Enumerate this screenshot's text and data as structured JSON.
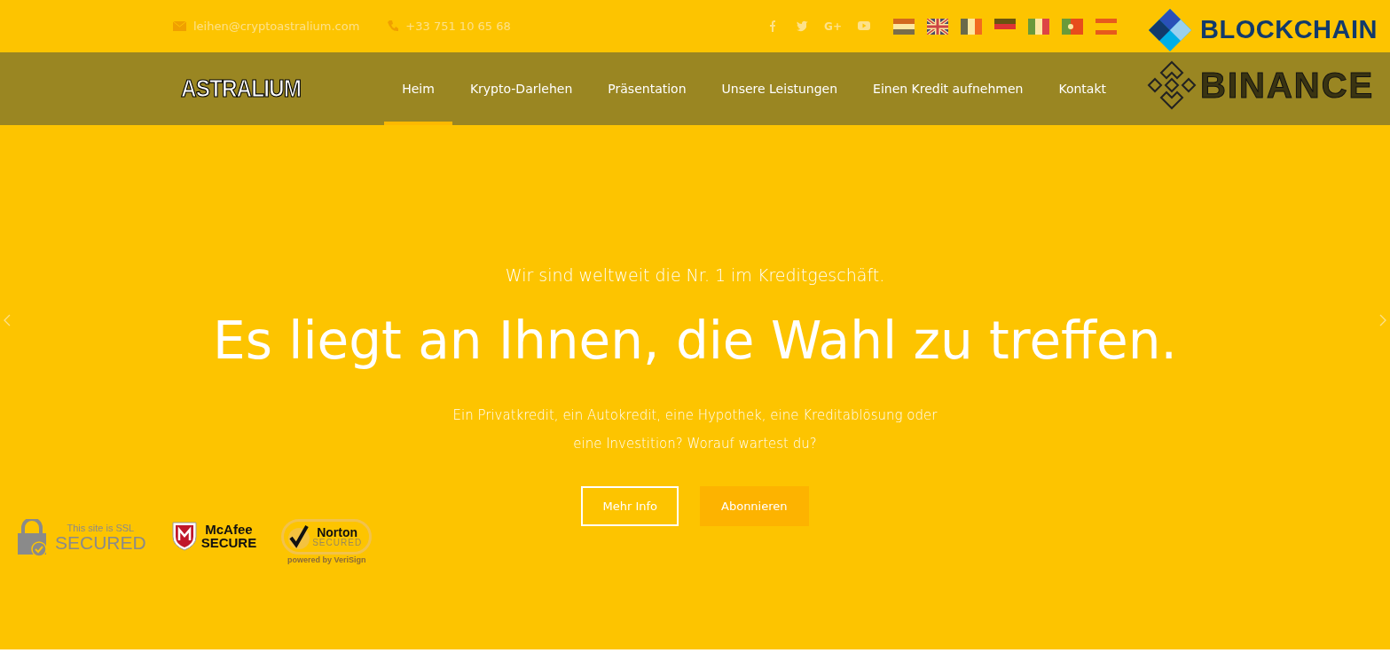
{
  "topbar": {
    "email": "leihen@cryptoastralium.com",
    "phone": "+33 751 10 65 68",
    "social": [
      {
        "kind": "facebook"
      },
      {
        "kind": "twitter"
      },
      {
        "kind": "googleplus",
        "label": "G+"
      },
      {
        "kind": "youtube"
      }
    ],
    "flags": [
      {
        "kind": "nl"
      },
      {
        "kind": "uk"
      },
      {
        "kind": "fr"
      },
      {
        "kind": "de"
      },
      {
        "kind": "it"
      },
      {
        "kind": "pt"
      },
      {
        "kind": "es"
      }
    ]
  },
  "navbar": {
    "logo": "ASTRALIUM",
    "items": [
      {
        "label": "Heim",
        "selected": true
      },
      {
        "label": "Krypto-Darlehen",
        "selected": false
      },
      {
        "label": "Präsentation",
        "selected": false
      },
      {
        "label": "Unsere Leistungen",
        "selected": false
      },
      {
        "label": "Einen Kredit aufnehmen",
        "selected": false
      },
      {
        "label": "Kontakt",
        "selected": false
      }
    ]
  },
  "partner_logos": [
    {
      "kind": "blockchain",
      "name": "BLOCKCHAIN"
    },
    {
      "kind": "binance",
      "name": "BINANCE"
    }
  ],
  "hero": {
    "subtitle": "Wir sind weltweit die Nr. 1 im Kreditgeschäft.",
    "headline": "Es liegt an Ihnen, die Wahl zu treffen.",
    "text": [
      "Ein Privatkredit, ein Autokredit, eine Hypothek, eine Kreditablösung oder",
      "eine Investition? Worauf wartest du?"
    ],
    "buttons": [
      {
        "label": "Mehr Info",
        "kind": "outline"
      },
      {
        "label": "Abonnieren",
        "kind": "filled"
      }
    ]
  },
  "trust_badges": [
    {
      "kind": "ssl",
      "lines": [
        "This site is SSL",
        "SECURED"
      ]
    },
    {
      "kind": "mcafee",
      "lines": [
        "McAfee",
        "SECURE"
      ]
    },
    {
      "kind": "norton",
      "lines": [
        "Norton",
        "SECURED",
        "powered by VeriSign"
      ]
    }
  ]
}
